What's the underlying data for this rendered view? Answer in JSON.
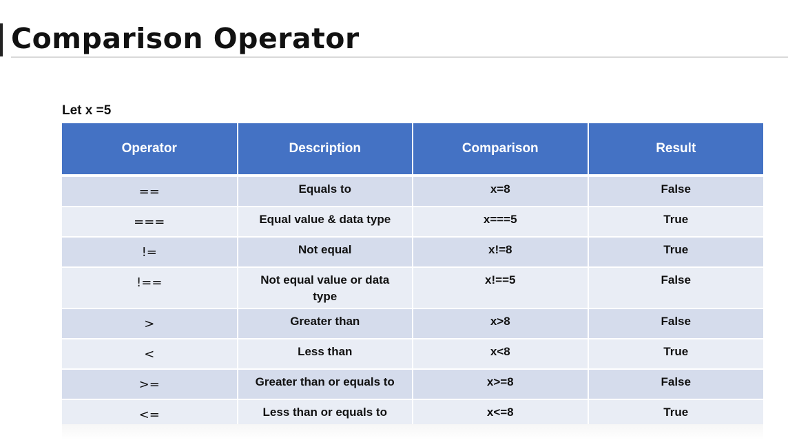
{
  "title": "Comparison Operator",
  "premise": "Let x =5",
  "table": {
    "headers": [
      "Operator",
      "Description",
      "Comparison",
      "Result"
    ],
    "rows": [
      {
        "operator": "==",
        "description": "Equals to",
        "comparison": "x=8",
        "result": "False"
      },
      {
        "operator": "===",
        "description": "Equal value & data type",
        "comparison": "x===5",
        "result": "True"
      },
      {
        "operator": "!=",
        "description": "Not equal",
        "comparison": "x!=8",
        "result": "True"
      },
      {
        "operator": "!==",
        "description": "Not equal value or data type",
        "comparison": "x!==5",
        "result": "False"
      },
      {
        "operator": ">",
        "description": "Greater than",
        "comparison": "x>8",
        "result": "False"
      },
      {
        "operator": "<",
        "description": "Less than",
        "comparison": "x<8",
        "result": "True"
      },
      {
        "operator": ">=",
        "description": "Greater than or equals to",
        "comparison": "x>=8",
        "result": "False"
      },
      {
        "operator": "<=",
        "description": "Less than or equals to",
        "comparison": "x<=8",
        "result": "True"
      }
    ]
  },
  "colors": {
    "header_bg": "#4472c4",
    "row_dark": "#d5dcec",
    "row_light": "#e9edf5"
  }
}
